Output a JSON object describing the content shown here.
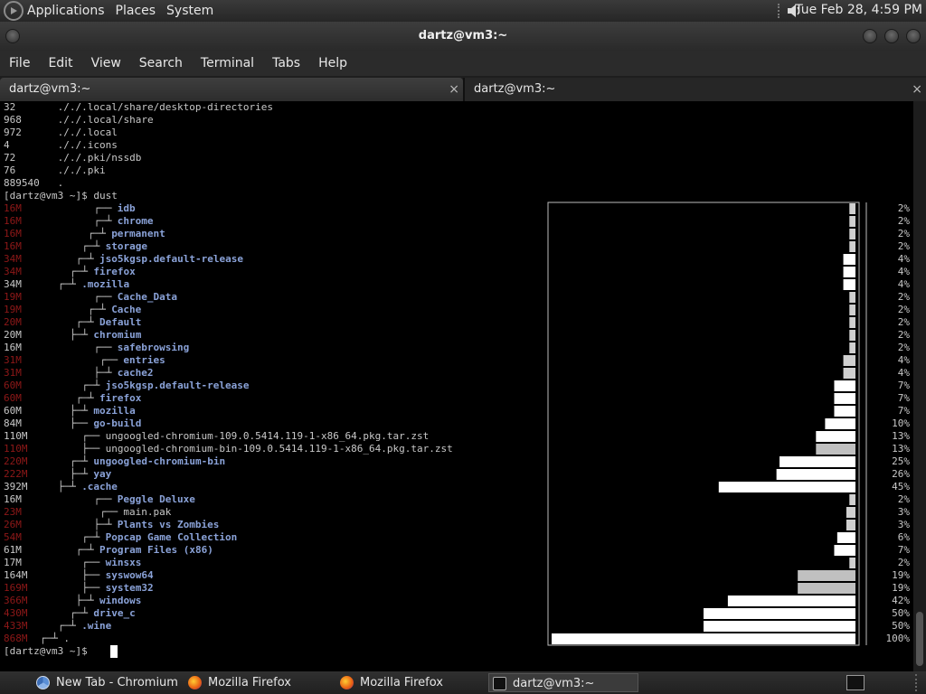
{
  "top_panel": {
    "menus": [
      "Applications",
      "Places",
      "System"
    ],
    "clock": "Tue Feb 28,  4:59 PM"
  },
  "window": {
    "title": "dartz@vm3:~",
    "menu": [
      "File",
      "Edit",
      "View",
      "Search",
      "Terminal",
      "Tabs",
      "Help"
    ],
    "tabs": [
      {
        "label": "dartz@vm3:~",
        "close": "×"
      },
      {
        "label": "dartz@vm3:~",
        "close": "×"
      }
    ]
  },
  "terminal": {
    "du_lines": [
      {
        "size": "32",
        "path": "././.local/share/desktop-directories"
      },
      {
        "size": "968",
        "path": "././.local/share"
      },
      {
        "size": "972",
        "path": "././.local"
      },
      {
        "size": "4",
        "path": "././.icons"
      },
      {
        "size": "72",
        "path": "././.pki/nssdb"
      },
      {
        "size": "76",
        "path": "././.pki"
      },
      {
        "size": "889540",
        "path": "."
      }
    ],
    "prompt_cmd": "[dartz@vm3 ~]$ dust",
    "final_prompt": "[dartz@vm3 ~]$ ",
    "dust_rows": [
      {
        "size": "16M",
        "red": true,
        "tree": "         ┌──",
        "name": "idb",
        "pct": "2%",
        "bar": 0.02,
        "col": "#d0d0d0"
      },
      {
        "size": "16M",
        "red": true,
        "tree": "         ┌─┴",
        "name": "chrome",
        "pct": "2%",
        "bar": 0.02,
        "col": "#d0d0d0"
      },
      {
        "size": "16M",
        "red": true,
        "tree": "        ┌─┴",
        "name": "permanent",
        "pct": "2%",
        "bar": 0.02,
        "col": "#d0d0d0"
      },
      {
        "size": "16M",
        "red": true,
        "tree": "       ┌─┴",
        "name": "storage",
        "pct": "2%",
        "bar": 0.02,
        "col": "#d0d0d0"
      },
      {
        "size": "34M",
        "red": true,
        "tree": "      ┌─┴",
        "name": "jso5kgsp.default-release",
        "pct": "4%",
        "bar": 0.04,
        "col": "#ffffff"
      },
      {
        "size": "34M",
        "red": true,
        "tree": "     ┌─┴",
        "name": "firefox",
        "pct": "4%",
        "bar": 0.04,
        "col": "#ffffff"
      },
      {
        "size": "34M",
        "red": false,
        "tree": "   ┌─┴",
        "name": ".mozilla",
        "pct": "4%",
        "bar": 0.04,
        "col": "#ffffff"
      },
      {
        "size": "19M",
        "red": true,
        "tree": "         ┌──",
        "name": "Cache_Data",
        "pct": "2%",
        "bar": 0.02,
        "col": "#d0d0d0"
      },
      {
        "size": "19M",
        "red": true,
        "tree": "        ┌─┴",
        "name": "Cache",
        "pct": "2%",
        "bar": 0.02,
        "col": "#d0d0d0"
      },
      {
        "size": "20M",
        "red": true,
        "tree": "      ┌─┴",
        "name": "Default",
        "pct": "2%",
        "bar": 0.02,
        "col": "#d0d0d0"
      },
      {
        "size": "20M",
        "red": false,
        "tree": "     ├─┴",
        "name": "chromium",
        "pct": "2%",
        "bar": 0.02,
        "col": "#d0d0d0"
      },
      {
        "size": "16M",
        "red": false,
        "tree": "         ┌──",
        "name": "safebrowsing",
        "pct": "2%",
        "bar": 0.02,
        "col": "#d0d0d0"
      },
      {
        "size": "31M",
        "red": true,
        "tree": "          ┌──",
        "name": "entries",
        "pct": "4%",
        "bar": 0.04,
        "col": "#d0d0d0"
      },
      {
        "size": "31M",
        "red": true,
        "tree": "         ├─┴",
        "name": "cache2",
        "pct": "4%",
        "bar": 0.04,
        "col": "#d0d0d0"
      },
      {
        "size": "60M",
        "red": true,
        "tree": "       ┌─┴",
        "name": "jso5kgsp.default-release",
        "pct": "7%",
        "bar": 0.07,
        "col": "#ffffff"
      },
      {
        "size": "60M",
        "red": true,
        "tree": "      ┌─┴",
        "name": "firefox",
        "pct": "7%",
        "bar": 0.07,
        "col": "#ffffff"
      },
      {
        "size": "60M",
        "red": false,
        "tree": "     ├─┴",
        "name": "mozilla",
        "pct": "7%",
        "bar": 0.07,
        "col": "#ffffff"
      },
      {
        "size": "84M",
        "red": false,
        "tree": "     ├──",
        "name": "go-build",
        "pct": "10%",
        "bar": 0.1,
        "col": "#ffffff"
      },
      {
        "size": "110M",
        "red": false,
        "tree": "       ┌──",
        "name": "ungoogled-chromium-109.0.5414.119-1-x86_64.pkg.tar.zst",
        "file": true,
        "pct": "13%",
        "bar": 0.13,
        "col": "#ffffff"
      },
      {
        "size": "110M",
        "red": true,
        "tree": "       ├──",
        "name": "ungoogled-chromium-bin-109.0.5414.119-1-x86_64.pkg.tar.zst",
        "file": true,
        "pct": "13%",
        "bar": 0.13,
        "col": "#c0c0c0"
      },
      {
        "size": "220M",
        "red": true,
        "tree": "     ┌─┴",
        "name": "ungoogled-chromium-bin",
        "pct": "25%",
        "bar": 0.25,
        "col": "#ffffff"
      },
      {
        "size": "222M",
        "red": true,
        "tree": "     ├─┴",
        "name": "yay",
        "pct": "26%",
        "bar": 0.26,
        "col": "#ffffff"
      },
      {
        "size": "392M",
        "red": false,
        "tree": "   ├─┴",
        "name": ".cache",
        "pct": "45%",
        "bar": 0.45,
        "col": "#ffffff"
      },
      {
        "size": "16M",
        "red": false,
        "tree": "         ┌──",
        "name": "Peggle Deluxe",
        "pct": "2%",
        "bar": 0.02,
        "col": "#d0d0d0"
      },
      {
        "size": "23M",
        "red": true,
        "tree": "          ┌──",
        "name": "main.pak",
        "file": true,
        "pct": "3%",
        "bar": 0.03,
        "col": "#d0d0d0"
      },
      {
        "size": "26M",
        "red": true,
        "tree": "         ├─┴",
        "name": "Plants vs Zombies",
        "pct": "3%",
        "bar": 0.03,
        "col": "#d0d0d0"
      },
      {
        "size": "54M",
        "red": true,
        "tree": "       ┌─┴",
        "name": "Popcap Game Collection",
        "pct": "6%",
        "bar": 0.06,
        "col": "#ffffff"
      },
      {
        "size": "61M",
        "red": false,
        "tree": "      ┌─┴",
        "name": "Program Files (x86)",
        "pct": "7%",
        "bar": 0.07,
        "col": "#ffffff"
      },
      {
        "size": "17M",
        "red": false,
        "tree": "       ┌──",
        "name": "winsxs",
        "pct": "2%",
        "bar": 0.02,
        "col": "#d0d0d0"
      },
      {
        "size": "164M",
        "red": false,
        "tree": "       ├──",
        "name": "syswow64",
        "pct": "19%",
        "bar": 0.19,
        "col": "#c0c0c0"
      },
      {
        "size": "169M",
        "red": true,
        "tree": "       ├──",
        "name": "system32",
        "pct": "19%",
        "bar": 0.19,
        "col": "#c0c0c0"
      },
      {
        "size": "366M",
        "red": true,
        "tree": "      ├─┴",
        "name": "windows",
        "pct": "42%",
        "bar": 0.42,
        "col": "#ffffff"
      },
      {
        "size": "430M",
        "red": true,
        "tree": "     ┌─┴",
        "name": "drive_c",
        "pct": "50%",
        "bar": 0.5,
        "col": "#ffffff"
      },
      {
        "size": "433M",
        "red": true,
        "tree": "   ┌─┴",
        "name": ".wine",
        "pct": "50%",
        "bar": 0.5,
        "col": "#ffffff"
      },
      {
        "size": "868M",
        "red": true,
        "tree": "┌─┴",
        "name": ".",
        "file": true,
        "pct": "100%",
        "bar": 1.0,
        "col": "#ffffff"
      }
    ]
  },
  "taskbar": {
    "tasks": [
      {
        "label": "New Tab - Chromium",
        "icon": "chromium-icon"
      },
      {
        "label": "Mozilla Firefox",
        "icon": "firefox-icon"
      },
      {
        "label": "Mozilla Firefox",
        "icon": "firefox-icon"
      },
      {
        "label": "dartz@vm3:~",
        "icon": "terminal-icon"
      }
    ]
  }
}
